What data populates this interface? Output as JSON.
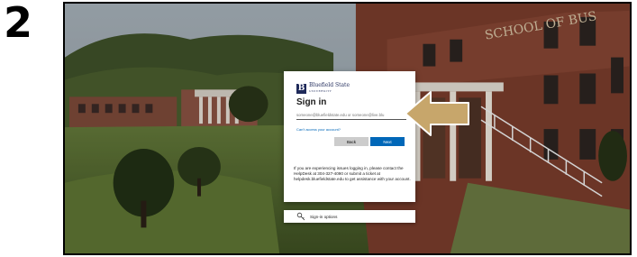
{
  "step": {
    "number": "2"
  },
  "login": {
    "logo": {
      "mark": "B",
      "name": "Bluefield State",
      "tagline": "UNIVERSITY"
    },
    "title": "Sign in",
    "email_placeholder": "someone@bluefieldstate.edu or someone@live.blu",
    "no_account_link": "Can't access your account?",
    "back_label": "Back",
    "next_label": "Next",
    "helpdesk_note": "If you are experiencing issues logging in, please contact the HelpDesk at 304-327-4090 or submit a ticket at helpdesk.bluefieldstate.edu to get assistance with your account.",
    "options_label": "Sign-in options",
    "options_icon": "key-icon"
  },
  "colors": {
    "accent": "#0067b8",
    "arrow": "#c7a66b",
    "back_button": "#cccccc"
  }
}
